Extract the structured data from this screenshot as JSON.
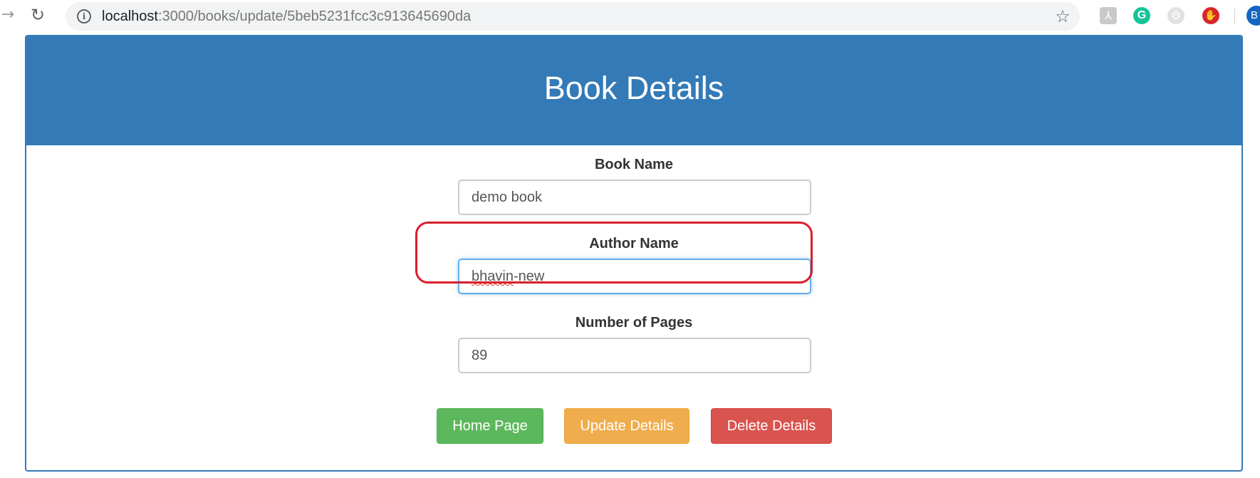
{
  "browser": {
    "url_host": "localhost",
    "url_path": ":3000/books/update/5beb5231fcc3c913645690da",
    "icons": {
      "forward": "forward-arrow-icon",
      "reload": "reload-icon",
      "info": "info-icon",
      "bookmark": "star-icon",
      "extensions": [
        "pdf-extension-icon",
        "grammarly-icon",
        "gear-extension-icon",
        "hand-block-icon"
      ],
      "profile": "avatar"
    },
    "extension_g_glyph": "G",
    "profile_initial": "B"
  },
  "page": {
    "title": "Book Details",
    "fields": [
      {
        "label": "Book Name",
        "value": "demo book"
      },
      {
        "label": "Author Name",
        "value_misspelled": "bhavin",
        "value_rest": "-new",
        "focused": true
      },
      {
        "label": "Number of Pages",
        "value": "89"
      }
    ],
    "buttons": {
      "home": "Home Page",
      "update": "Update Details",
      "delete": "Delete Details"
    },
    "colors": {
      "heading": "#337ab7",
      "home": "#5cb85c",
      "update": "#f0ad4e",
      "delete": "#d9534f",
      "annotation": "#d7202b"
    }
  }
}
